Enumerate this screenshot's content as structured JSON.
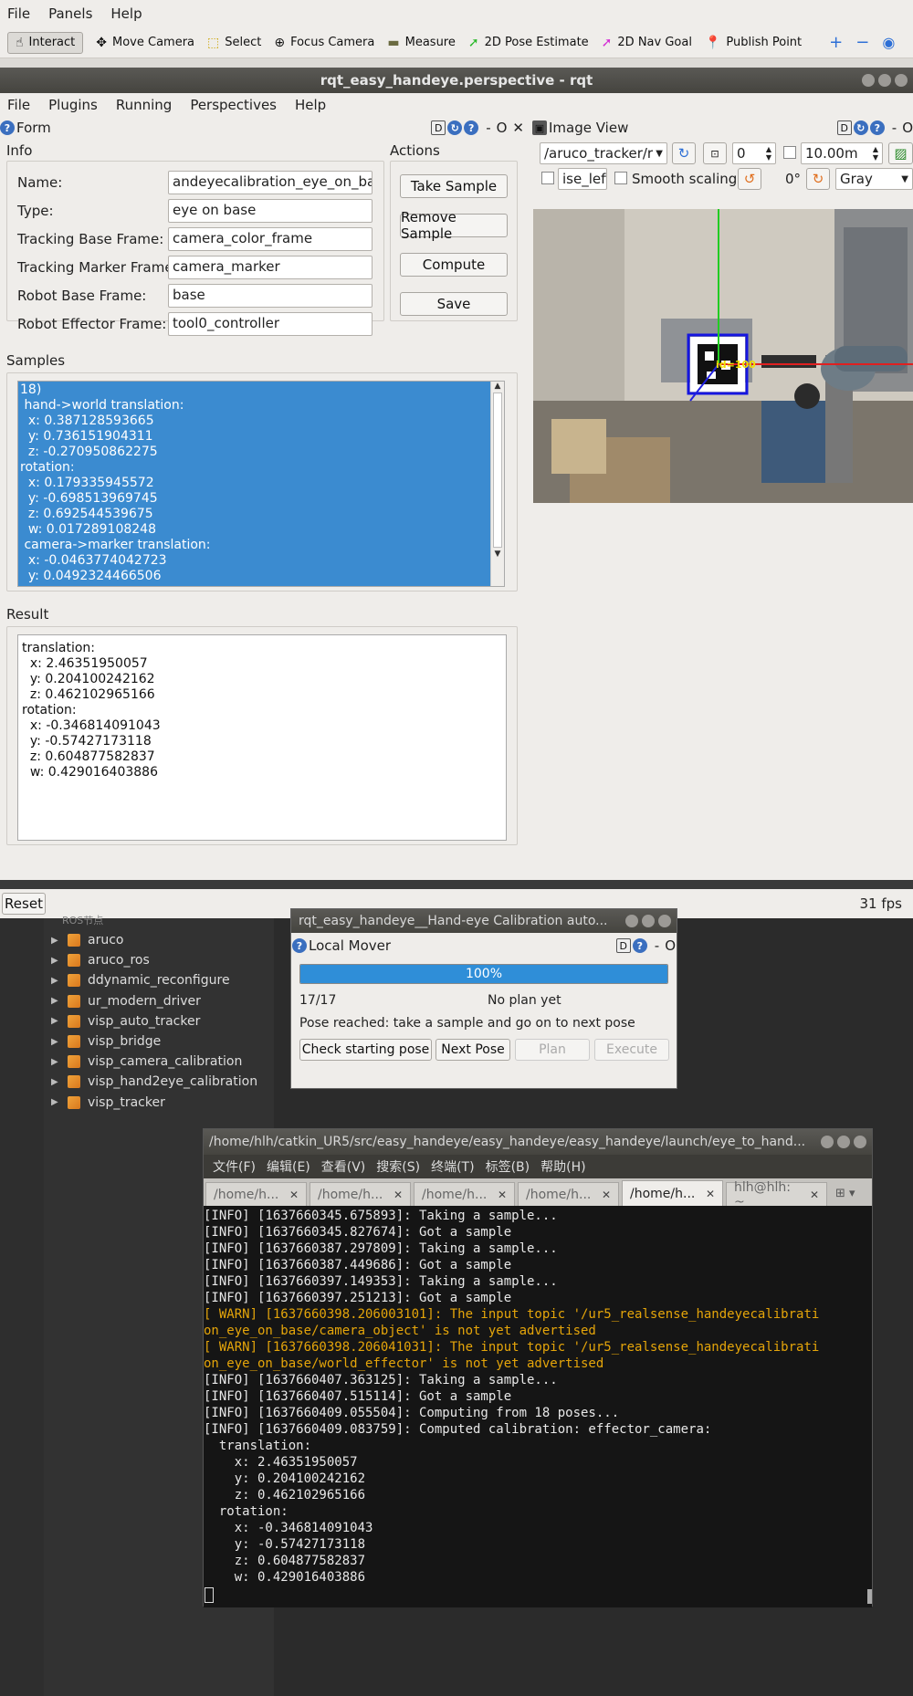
{
  "rviz": {
    "menu": [
      "File",
      "Panels",
      "Help"
    ],
    "toolbar": [
      {
        "label": "Interact",
        "icon": "cursor-icon",
        "active": true
      },
      {
        "label": "Move Camera",
        "icon": "move-camera-icon"
      },
      {
        "label": "Select",
        "icon": "select-icon"
      },
      {
        "label": "Focus Camera",
        "icon": "focus-camera-icon"
      },
      {
        "label": "Measure",
        "icon": "measure-icon"
      },
      {
        "label": "2D Pose Estimate",
        "icon": "pose-estimate-icon"
      },
      {
        "label": "2D Nav Goal",
        "icon": "nav-goal-icon"
      },
      {
        "label": "Publish Point",
        "icon": "publish-point-icon"
      }
    ],
    "reset_label": "Reset",
    "fps": "31 fps"
  },
  "rqt": {
    "window_title": "rqt_easy_handeye.perspective - rqt",
    "menu": [
      "File",
      "Plugins",
      "Running",
      "Perspectives",
      "Help"
    ],
    "form": {
      "title": "Form",
      "info_label": "Info",
      "actions_label": "Actions",
      "fields": [
        {
          "label": "Name:",
          "value": "andeyecalibration_eye_on_base/"
        },
        {
          "label": "Type:",
          "value": "eye on base"
        },
        {
          "label": "Tracking Base Frame:",
          "value": "camera_color_frame"
        },
        {
          "label": "Tracking Marker Frame:",
          "value": "camera_marker"
        },
        {
          "label": "Robot Base Frame:",
          "value": "base"
        },
        {
          "label": "Robot Effector Frame:",
          "value": "tool0_controller"
        }
      ],
      "actions": [
        "Take Sample",
        "Remove Sample",
        "Compute",
        "Save"
      ],
      "samples_label": "Samples",
      "samples_lines": [
        "18)",
        " hand->world translation:",
        "  x: 0.387128593665",
        "  y: 0.736151904311",
        "  z: -0.270950862275",
        "rotation:",
        "  x: 0.179335945572",
        "  y: -0.698513969745",
        "  z: 0.692544539675",
        "  w: 0.017289108248",
        " camera->marker translation:",
        "  x: -0.0463774042723",
        "  y: 0.0492324466506"
      ],
      "result_label": "Result",
      "result_lines": [
        "translation:",
        "  x: 2.46351950057",
        "  y: 0.204100242162",
        "  z: 0.462102965166",
        "rotation:",
        "  x: -0.346814091043",
        "  y: -0.57427173118",
        "  z: 0.604877582837",
        "  w: 0.429016403886"
      ]
    },
    "image_view": {
      "title": "Image View",
      "topic": "/aruco_tracker/r",
      "spin_value": "0",
      "range_value": "10.00m",
      "checkbox_value": "ise_left",
      "smooth_label": "Smooth scaling",
      "rotation_label": "0°",
      "color_mode": "Gray",
      "marker_label": "id=100"
    }
  },
  "ros_tree": {
    "header": "ROS节点",
    "items": [
      "aruco",
      "aruco_ros",
      "ddynamic_reconfigure",
      "ur_modern_driver",
      "visp_auto_tracker",
      "visp_bridge",
      "visp_camera_calibration",
      "visp_hand2eye_calibration",
      "visp_tracker"
    ]
  },
  "mover": {
    "window_title": "rqt_easy_handeye__Hand-eye Calibration auto...",
    "panel_title": "Local Mover",
    "progress_text": "100%",
    "progress": 1.0,
    "counter": "17/17",
    "plan_status": "No plan yet",
    "message": "Pose reached: take a sample and go on to next pose",
    "buttons": [
      "Check starting pose",
      "Next Pose",
      "Plan",
      "Execute"
    ]
  },
  "terminal": {
    "title": "/home/hlh/catkin_UR5/src/easy_handeye/easy_handeye/easy_handeye/launch/eye_to_hand...",
    "menu": [
      "文件(F)",
      "编辑(E)",
      "查看(V)",
      "搜索(S)",
      "终端(T)",
      "标签(B)",
      "帮助(H)"
    ],
    "tabs": [
      "/home/h...",
      "/home/h...",
      "/home/h...",
      "/home/h...",
      "/home/h...",
      "hlh@hlh: ~"
    ],
    "lines": [
      {
        "t": "[INFO] [1637660345.675893]: Taking a sample...",
        "w": false
      },
      {
        "t": "[INFO] [1637660345.827674]: Got a sample",
        "w": false
      },
      {
        "t": "[INFO] [1637660387.297809]: Taking a sample...",
        "w": false
      },
      {
        "t": "[INFO] [1637660387.449686]: Got a sample",
        "w": false
      },
      {
        "t": "[INFO] [1637660397.149353]: Taking a sample...",
        "w": false
      },
      {
        "t": "[INFO] [1637660397.251213]: Got a sample",
        "w": false
      },
      {
        "t": "[ WARN] [1637660398.206003101]: The input topic '/ur5_realsense_handeyecalibrati",
        "w": true
      },
      {
        "t": "on_eye_on_base/camera_object' is not yet advertised",
        "w": true
      },
      {
        "t": "[ WARN] [1637660398.206041031]: The input topic '/ur5_realsense_handeyecalibrati",
        "w": true
      },
      {
        "t": "on_eye_on_base/world_effector' is not yet advertised",
        "w": true
      },
      {
        "t": "[INFO] [1637660407.363125]: Taking a sample...",
        "w": false
      },
      {
        "t": "[INFO] [1637660407.515114]: Got a sample",
        "w": false
      },
      {
        "t": "[INFO] [1637660409.055504]: Computing from 18 poses...",
        "w": false
      },
      {
        "t": "[INFO] [1637660409.083759]: Computed calibration: effector_camera:",
        "w": false
      },
      {
        "t": "  translation:",
        "w": false
      },
      {
        "t": "    x: 2.46351950057",
        "w": false
      },
      {
        "t": "    y: 0.204100242162",
        "w": false
      },
      {
        "t": "    z: 0.462102965166",
        "w": false
      },
      {
        "t": "  rotation:",
        "w": false
      },
      {
        "t": "    x: -0.346814091043",
        "w": false
      },
      {
        "t": "    y: -0.57427173118",
        "w": false
      },
      {
        "t": "    z: 0.604877582837",
        "w": false
      },
      {
        "t": "    w: 0.429016403886",
        "w": false
      }
    ]
  }
}
